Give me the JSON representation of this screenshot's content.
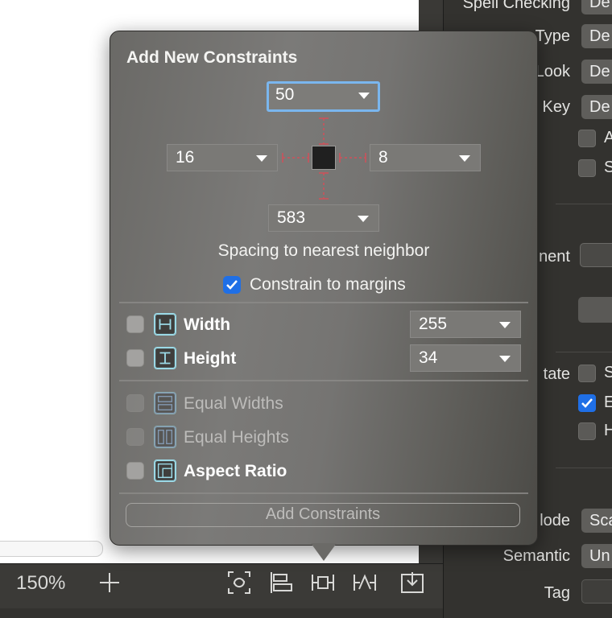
{
  "popover": {
    "title": "Add New Constraints",
    "top": "50",
    "left": "16",
    "right": "8",
    "bottom": "583",
    "spacing_caption": "Spacing to nearest neighbor",
    "constrain_to_margins": {
      "label": "Constrain to margins",
      "checked": true
    },
    "width": {
      "label": "Width",
      "value": "255",
      "checked": false
    },
    "height": {
      "label": "Height",
      "value": "34",
      "checked": false
    },
    "equal_widths": {
      "label": "Equal Widths",
      "enabled": false
    },
    "equal_heights": {
      "label": "Equal Heights",
      "enabled": false
    },
    "aspect_ratio": {
      "label": "Aspect Ratio",
      "checked": false
    },
    "add_button": "Add Constraints"
  },
  "toolbar": {
    "zoom": "150%",
    "icons": [
      "add-icon",
      "update-frames-icon",
      "align-icon",
      "add-constraints-icon",
      "resolve-issues-icon",
      "embed-in-icon"
    ]
  },
  "inspector": {
    "rows": [
      {
        "label": "Spell Checking",
        "value": "De"
      },
      {
        "label": "Type",
        "value": "De"
      },
      {
        "label": "Look",
        "value": "De"
      },
      {
        "label": "Key",
        "value": "De"
      },
      {
        "label": "nent"
      },
      {
        "label": "tate"
      },
      {
        "label": "lode",
        "value": "Sca"
      },
      {
        "label": "Semantic",
        "value": "Un"
      },
      {
        "label": "Tag"
      }
    ],
    "checks": [
      {
        "text": "A",
        "checked": false
      },
      {
        "text": "S",
        "checked": false
      },
      {
        "text": "S",
        "checked": false
      },
      {
        "text": "E",
        "checked": true
      },
      {
        "text": "H",
        "checked": false
      }
    ]
  },
  "colors": {
    "accent": "#1f6fe6",
    "focus_ring": "#7ab6ee",
    "constraint_red": "#d0505a",
    "icon_cyan": "#9bd9e6"
  }
}
